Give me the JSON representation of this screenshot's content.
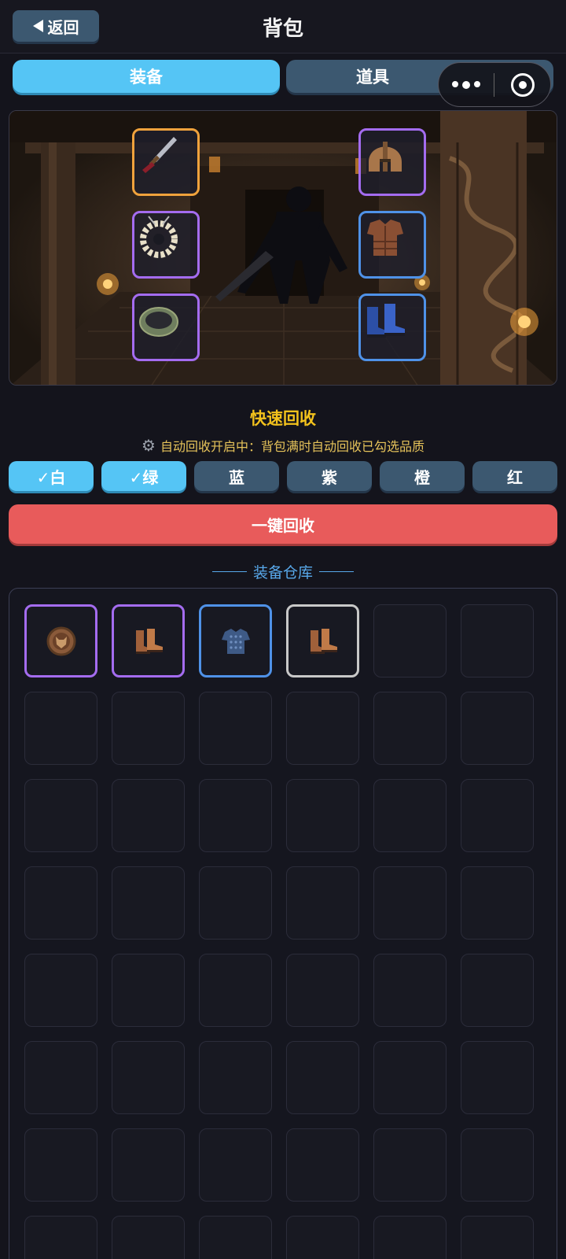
{
  "header": {
    "back_label": "返回",
    "title": "背包"
  },
  "tabs": [
    {
      "label": "装备"
    },
    {
      "label": "道具"
    }
  ],
  "equipped": [
    {
      "slot": "weapon",
      "icon": "dagger-icon",
      "quality": "orange"
    },
    {
      "slot": "necklace",
      "icon": "bone-necklace-icon",
      "quality": "purple"
    },
    {
      "slot": "ring",
      "icon": "jade-ring-icon",
      "quality": "purple"
    },
    {
      "slot": "helmet",
      "icon": "helmet-icon",
      "quality": "purple"
    },
    {
      "slot": "armor",
      "icon": "leather-armor-icon",
      "quality": "blue"
    },
    {
      "slot": "boots",
      "icon": "blue-boots-icon",
      "quality": "blue"
    }
  ],
  "quick_recycle": {
    "title": "快速回收",
    "description": "自动回收开启中：背包满时自动回收已勾选品质",
    "filters": [
      {
        "label": "✓白",
        "checked": true
      },
      {
        "label": "✓绿",
        "checked": true
      },
      {
        "label": "蓝",
        "checked": false
      },
      {
        "label": "紫",
        "checked": false
      },
      {
        "label": "橙",
        "checked": false
      },
      {
        "label": "红",
        "checked": false
      }
    ],
    "button_label": "一键回收"
  },
  "warehouse": {
    "title": "装备仓库",
    "items": [
      {
        "icon": "wolf-medallion-icon",
        "quality": "purple"
      },
      {
        "icon": "leather-boots-icon",
        "quality": "purple"
      },
      {
        "icon": "chainmail-shirt-icon",
        "quality": "blue"
      },
      {
        "icon": "leather-boots-icon",
        "quality": "white"
      }
    ]
  },
  "colors": {
    "accent_blue": "#55c5f5",
    "inactive": "#3c5870",
    "recycle_red": "#e85b5b",
    "gold_text": "#f3c21c",
    "quality_orange": "#f0a23c",
    "quality_purple": "#a46cf0",
    "quality_blue": "#4f92e8",
    "quality_white": "#c8c8c8"
  }
}
